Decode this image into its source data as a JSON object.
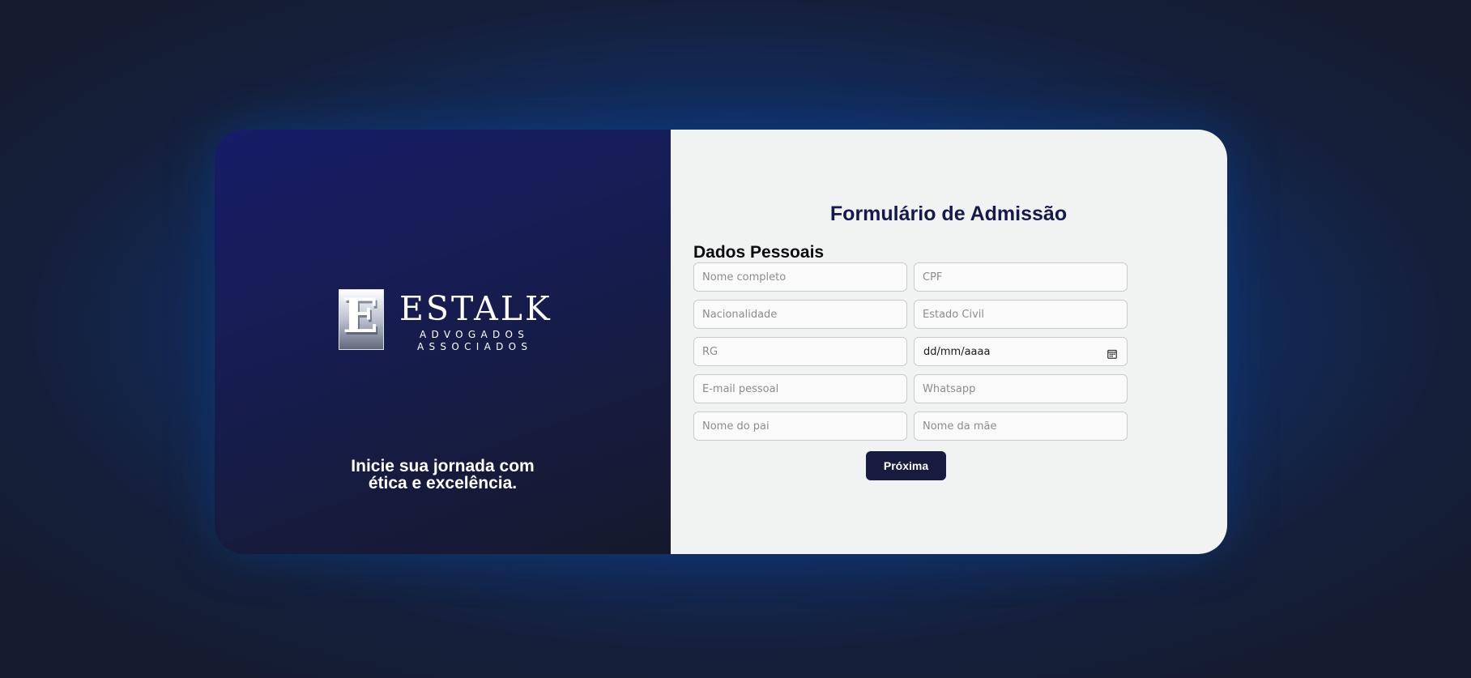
{
  "brand": {
    "logo_letter": "E",
    "name": "ESTALK",
    "sub_line1": "ADVOGADOS",
    "sub_line2": "ASSOCIADOS"
  },
  "tagline": {
    "line1": "Inicie sua jornada com",
    "line2": "ética e excelência."
  },
  "form": {
    "title": "Formulário de Admissão",
    "section_title": "Dados Pessoais",
    "fields": {
      "nome_completo": {
        "placeholder": "Nome completo",
        "value": ""
      },
      "cpf": {
        "placeholder": "CPF",
        "value": ""
      },
      "nacionalidade": {
        "placeholder": "Nacionalidade",
        "value": ""
      },
      "estado_civil": {
        "placeholder": "Estado Civil",
        "value": ""
      },
      "rg": {
        "placeholder": "RG",
        "value": ""
      },
      "data_nascimento": {
        "display": "dd/mm/aaaa",
        "icon": "calendar-icon"
      },
      "email_pessoal": {
        "placeholder": "E-mail pessoal",
        "value": ""
      },
      "whatsapp": {
        "placeholder": "Whatsapp",
        "value": ""
      },
      "nome_pai": {
        "placeholder": "Nome do pai",
        "value": ""
      },
      "nome_mae": {
        "placeholder": "Nome da mãe",
        "value": ""
      }
    },
    "next_label": "Próxima"
  },
  "colors": {
    "left_panel": "#161c66",
    "form_background": "#f1f2f2",
    "title": "#141a4a",
    "button": "#161b3f",
    "page_glow": "#0d4390"
  }
}
